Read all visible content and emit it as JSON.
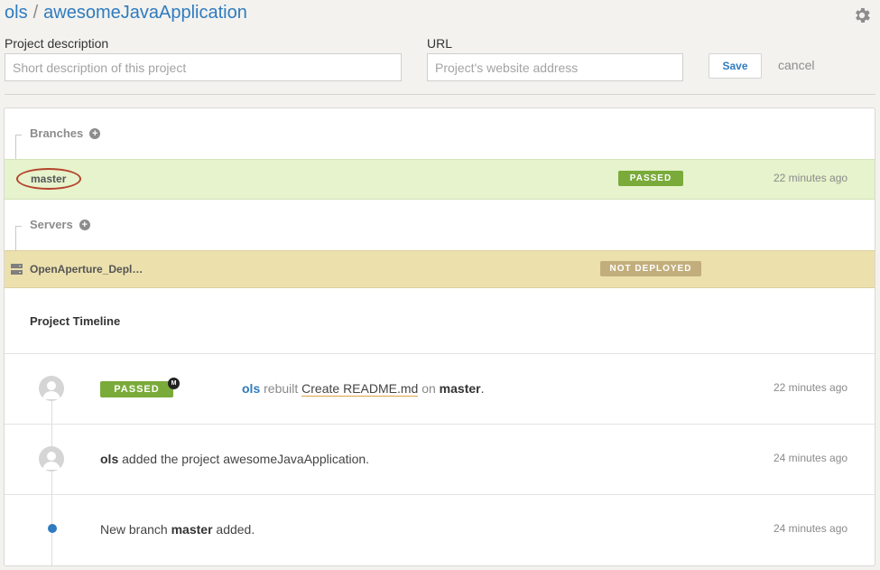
{
  "breadcrumb": {
    "owner": "ols",
    "separator": "/",
    "project": "awesomeJavaApplication"
  },
  "settings": {
    "icon": "gear-icon"
  },
  "form": {
    "description_label": "Project description",
    "description_placeholder": "Short description of this project",
    "url_label": "URL",
    "url_placeholder": "Project's website address",
    "save_label": "Save",
    "cancel_label": "cancel"
  },
  "branches": {
    "heading": "Branches",
    "add_icon": "plus-icon",
    "items": [
      {
        "name": "master",
        "status": "PASSED",
        "time": "22 minutes ago"
      }
    ]
  },
  "servers": {
    "heading": "Servers",
    "add_icon": "plus-icon",
    "items": [
      {
        "name": "OpenAperture_Depl…",
        "status": "NOT DEPLOYED",
        "icon": "server-icon"
      }
    ]
  },
  "timeline": {
    "title": "Project Timeline",
    "events": [
      {
        "badge": "PASSED",
        "badge_marker": "M",
        "user": "ols",
        "action": "rebuilt",
        "commit": "Create README.md",
        "preposition": "on",
        "branch": "master",
        "end": ".",
        "time": "22 minutes ago"
      },
      {
        "user": "ols",
        "text": "added the project awesomeJavaApplication.",
        "time": "24 minutes ago"
      },
      {
        "prefix": "New branch",
        "branch": "master",
        "suffix": "added.",
        "time": "24 minutes ago"
      }
    ]
  },
  "colors": {
    "link": "#2f7bbf",
    "passed": "#7aab3a",
    "not_deployed": "#c2ae7c",
    "branch_row": "#e6f3cc",
    "server_row": "#ece0ad",
    "highlight_ring": "#b5432d"
  }
}
